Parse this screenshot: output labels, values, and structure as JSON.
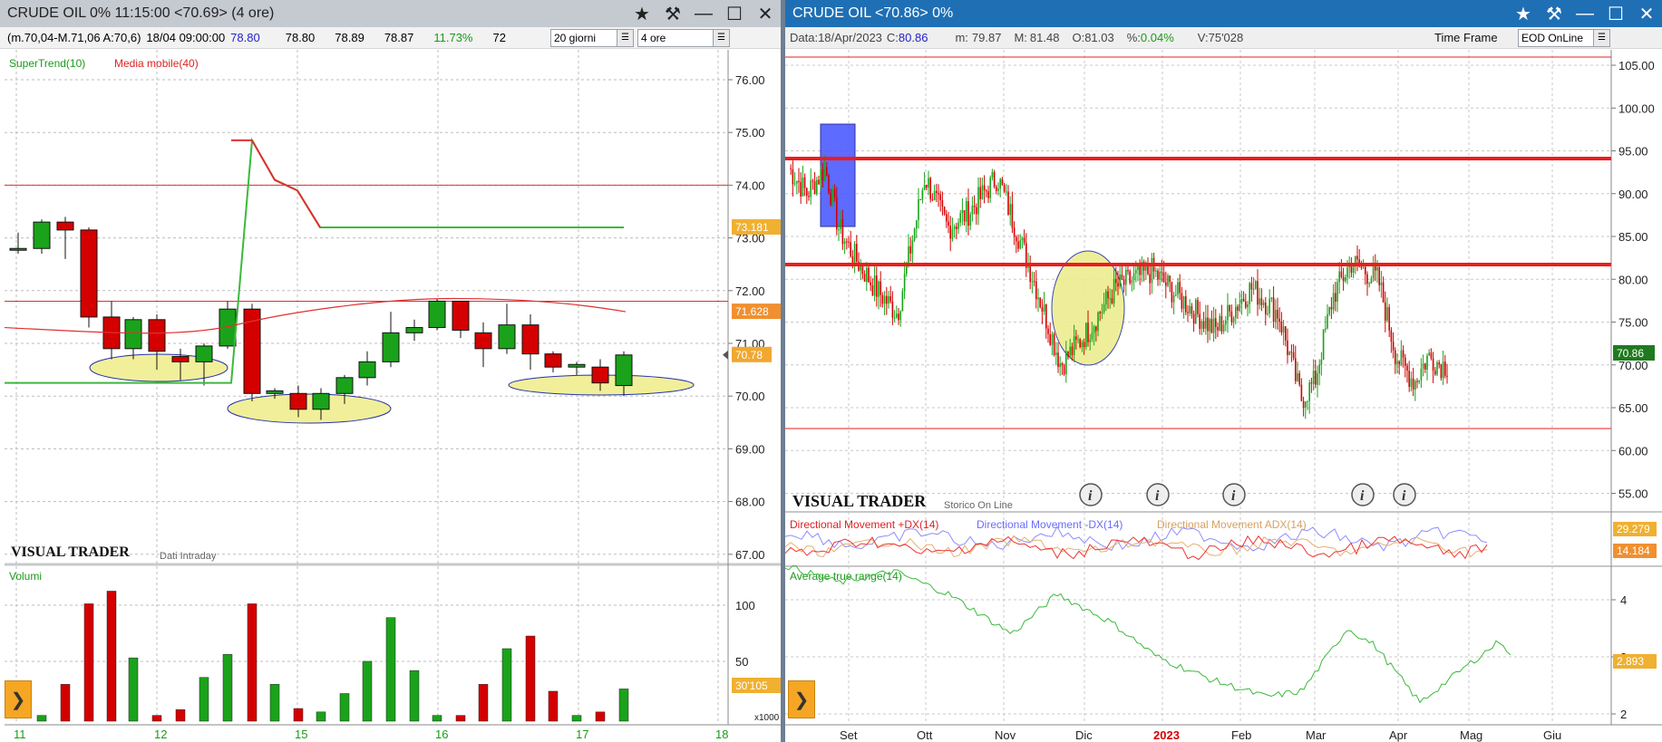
{
  "left": {
    "title": "CRUDE OIL 0% 11:15:00  <70.69> (4 ore)",
    "info": {
      "range": "(m.70,04-M.71,06 A:70,6)",
      "date": "18/04 09:00:00",
      "v1": "78.80",
      "v2": "78.80",
      "v3": "78.89",
      "v4": "78.87",
      "pct": "11.73%",
      "cut": "72"
    },
    "period_select": "20 giorni",
    "tf_select": "4 ore",
    "legend": {
      "supertrend": "SuperTrend(10)",
      "ma": "Media mobile(40)"
    },
    "brand": "VISUAL TRADER",
    "brand_sub": "Dati Intraday",
    "price_ticks": [
      "76.00",
      "75.00",
      "74.00",
      "73.00",
      "72.00",
      "71.00",
      "70.00",
      "69.00",
      "68.00",
      "67.00"
    ],
    "badges": {
      "supertrend": "73.181",
      "ma": "71.628",
      "last": "70.78",
      "vol": "30'105"
    },
    "vol_label": "Volumi",
    "vol_ticks": [
      "100",
      "50"
    ],
    "vol_multiplier": "x1000",
    "x_ticks": [
      "11",
      "12",
      "15",
      "16",
      "17",
      "18"
    ],
    "colors": {
      "up": "#1aa31a",
      "down": "#d40000",
      "supertrend": "#3cb93c",
      "ma": "#e03030",
      "ellipse": "#f2ef9a"
    }
  },
  "right": {
    "title": "CRUDE OIL <70.86> 0%",
    "info": {
      "data_label": "Data:",
      "data": "18/Apr/2023",
      "c_label": "C:",
      "c": "80.86",
      "m_label": "m:",
      "m": "79.87",
      "mx_label": "M:",
      "mx": "81.48",
      "o_label": "O:",
      "o": "81.03",
      "pct_label": "%:",
      "pct": "0.04%",
      "v_label": "V:",
      "v": "75'028"
    },
    "timeframe_label": "Time Frame",
    "timeframe_select": "EOD OnLine",
    "brand": "VISUAL TRADER",
    "brand_sub": "Storico On Line",
    "price_ticks": [
      "105.00",
      "100.00",
      "95.00",
      "90.00",
      "85.00",
      "80.00",
      "75.00",
      "70.00",
      "65.00",
      "60.00",
      "55.00"
    ],
    "last_badge": "70.86",
    "dmi_legend": {
      "plus": "Directional Movement +DX(14)",
      "minus": "Directional Movement -DX(14)",
      "adx": "Directional Movement ADX(14)"
    },
    "dmi_badges": {
      "top": "29.279",
      "bottom": "14.184"
    },
    "atr_label": "Average true range(14)",
    "atr_ticks": [
      "4",
      "3",
      "2"
    ],
    "atr_badge": "2.893",
    "x_ticks": [
      "Set",
      "Ott",
      "Nov",
      "Dic",
      "2023",
      "Feb",
      "Mar",
      "Apr",
      "Mag",
      "Giu"
    ],
    "colors": {
      "up": "#1aa31a",
      "down": "#d40000",
      "hline": "#ee1c1c",
      "plus_dx": "#e33",
      "minus_dx": "#8d8dff",
      "adx": "#e6b070",
      "atr": "#3cb93c"
    }
  }
}
